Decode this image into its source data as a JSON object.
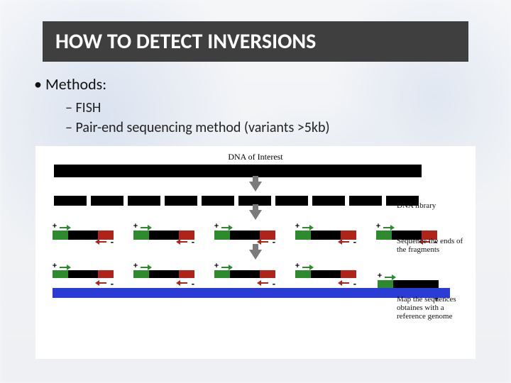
{
  "title": "HOW TO DETECT INVERSIONS",
  "bullets": {
    "l1": "Methods:",
    "l2a": "FISH",
    "l2b": "Pair-end sequencing method (variants >5kb)"
  },
  "diagram": {
    "top_label": "DNA of Interest",
    "lib_label": "DNA library",
    "seq_label": "Sequence the ends of the fragments",
    "map_label": "Map the sequences obtaines with a reference genome",
    "plus": "+",
    "minus": "-"
  }
}
